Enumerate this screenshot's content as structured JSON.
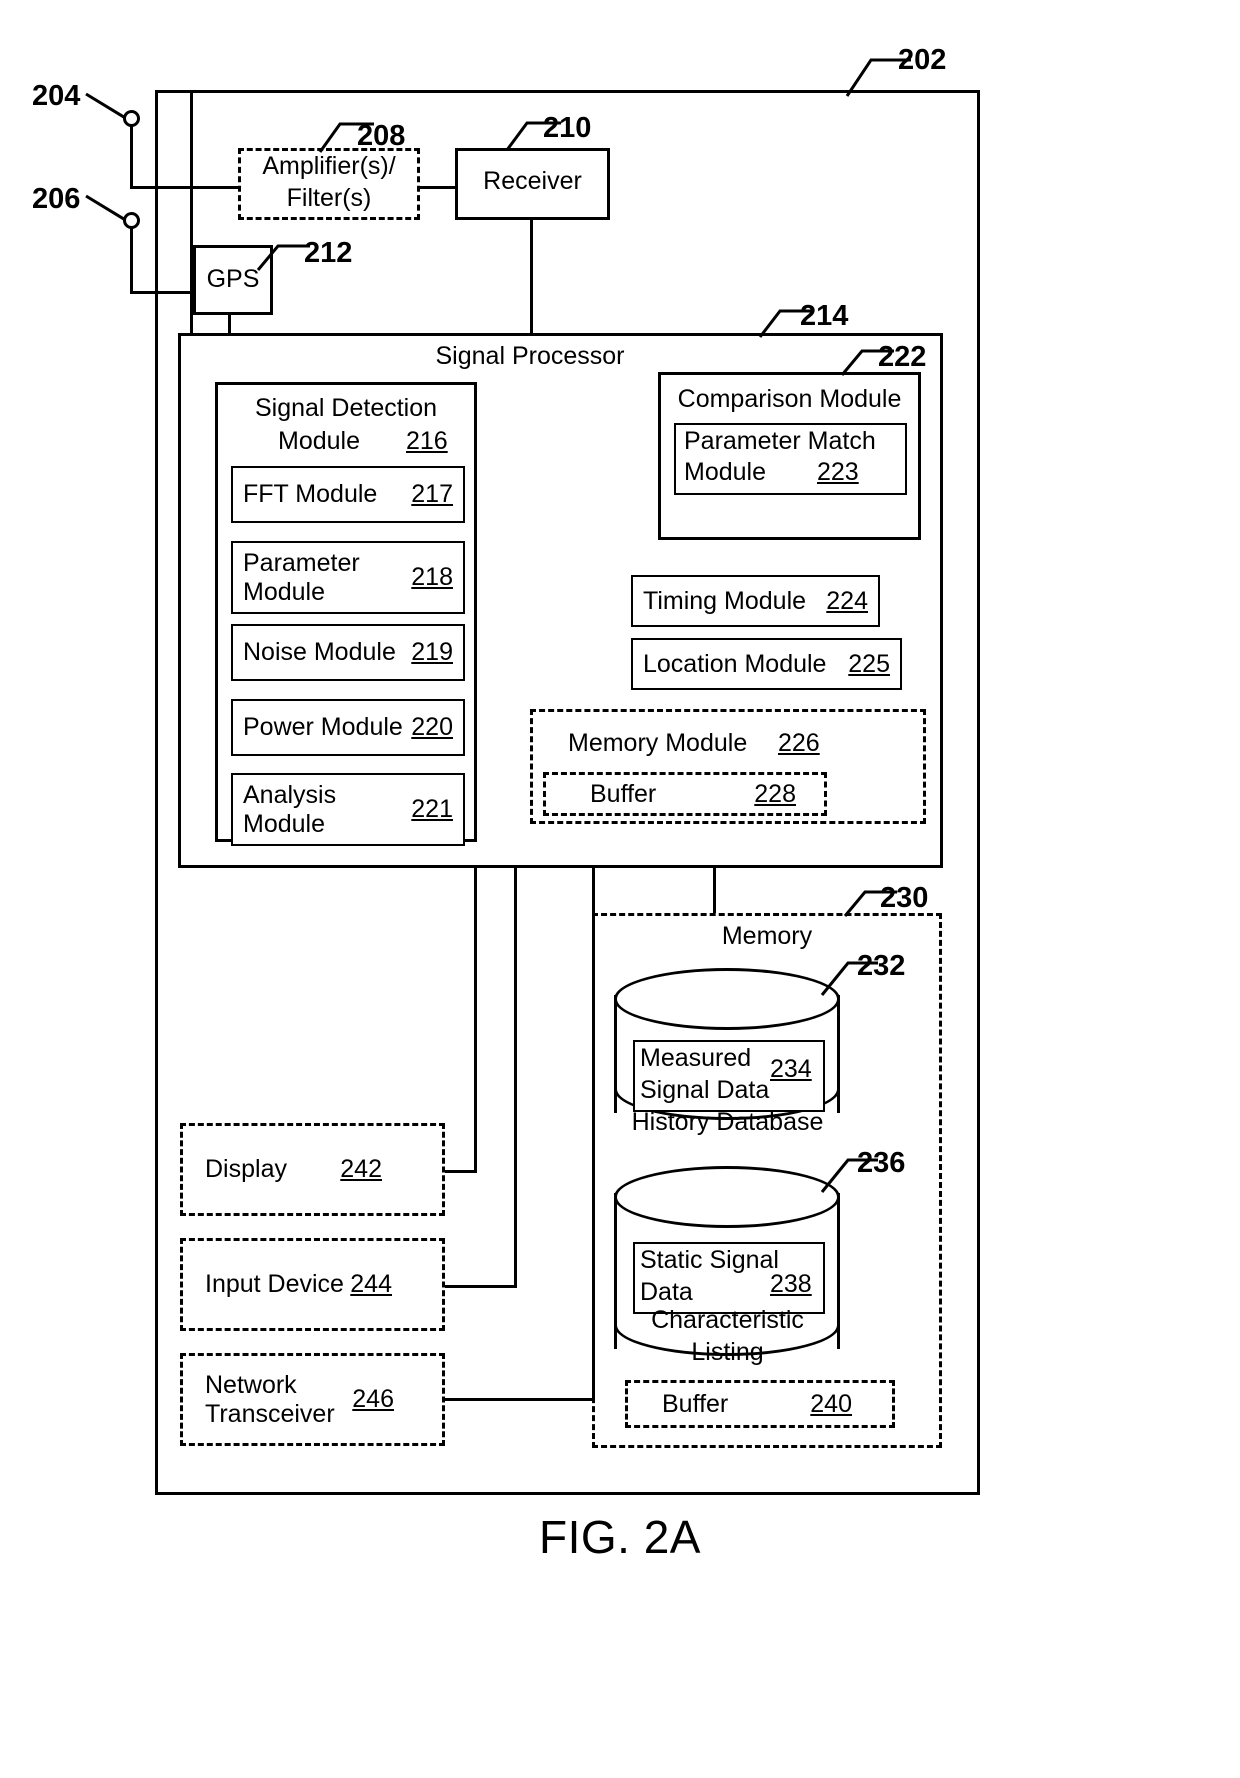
{
  "figure": {
    "caption": "FIG. 2A",
    "system_ref": "202"
  },
  "antennas": {
    "first": {
      "ref": "204"
    },
    "second": {
      "ref": "206"
    }
  },
  "front_end": {
    "amp_filter": {
      "line1": "Amplifier(s)/",
      "line2": "Filter(s)",
      "ref": "208"
    },
    "receiver": {
      "label": "Receiver",
      "ref": "210"
    },
    "gps": {
      "label": "GPS",
      "ref": "212"
    }
  },
  "signal_processor": {
    "title": "Signal Processor",
    "ref": "214",
    "detection_module": {
      "title_line1": "Signal Detection",
      "title_line2": "Module",
      "ref": "216",
      "submodules": [
        {
          "label": "FFT Module",
          "ref": "217"
        },
        {
          "label": "Parameter\nModule",
          "ref": "218"
        },
        {
          "label": "Noise Module",
          "ref": "219"
        },
        {
          "label": "Power Module",
          "ref": "220"
        },
        {
          "label": "Analysis\nModule",
          "ref": "221"
        }
      ]
    },
    "comparison_module": {
      "title": "Comparison Module",
      "ref": "222",
      "submodule": {
        "line1": "Parameter Match",
        "line2": "Module",
        "ref": "223"
      }
    },
    "timing_module": {
      "label": "Timing Module",
      "ref": "224"
    },
    "location_module": {
      "label": "Location Module",
      "ref": "225"
    },
    "memory_module": {
      "label": "Memory Module",
      "ref": "226",
      "buffer": {
        "label": "Buffer",
        "ref": "228"
      }
    }
  },
  "memory": {
    "title": "Memory",
    "ref": "230",
    "history_database": {
      "ref": "232",
      "inner_label_line1": "Measured",
      "inner_label_line2": "Signal Data",
      "inner_ref": "234",
      "caption": "History Database"
    },
    "characteristic_listing": {
      "ref": "236",
      "inner_label_line1": "Static Signal",
      "inner_label_line2": "Data",
      "inner_ref": "238",
      "caption_line1": "Characteristic",
      "caption_line2": "Listing"
    },
    "buffer": {
      "label": "Buffer",
      "ref": "240"
    }
  },
  "peripherals": [
    {
      "label": "Display",
      "ref": "242"
    },
    {
      "label": "Input Device",
      "ref": "244"
    },
    {
      "label": "Network\nTransceiver",
      "ref": "246"
    }
  ]
}
